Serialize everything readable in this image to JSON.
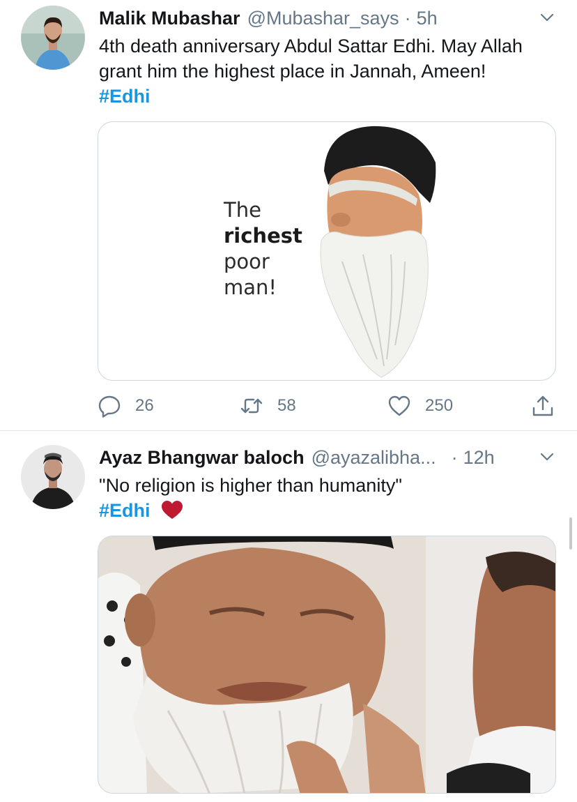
{
  "tweets": [
    {
      "name": "Malik Mubashar",
      "handle": "@Mubashar_says",
      "separator": "·",
      "time": "5h",
      "text": "4th death anniversary Abdul Sattar Edhi. May Allah grant him the highest place in Jannah, Ameen!",
      "hashtag": "#Edhi",
      "media": {
        "line1": "The",
        "line2": "richest",
        "line3": "poor",
        "line4": "man!"
      },
      "actions": {
        "replies": "26",
        "retweets": "58",
        "likes": "250"
      }
    },
    {
      "name": "Ayaz Bhangwar baloch",
      "handle": "@ayazalibha...",
      "separator": "·",
      "time": "12h",
      "text": "\"No religion is higher than humanity\"",
      "hashtag": "#Edhi"
    }
  ],
  "colors": {
    "link": "#1b95e0",
    "secondary": "#657786",
    "heart": "#be1931"
  },
  "icons": [
    "chevron-down-icon",
    "reply-icon",
    "retweet-icon",
    "like-icon",
    "share-icon",
    "red-heart-emoji"
  ]
}
